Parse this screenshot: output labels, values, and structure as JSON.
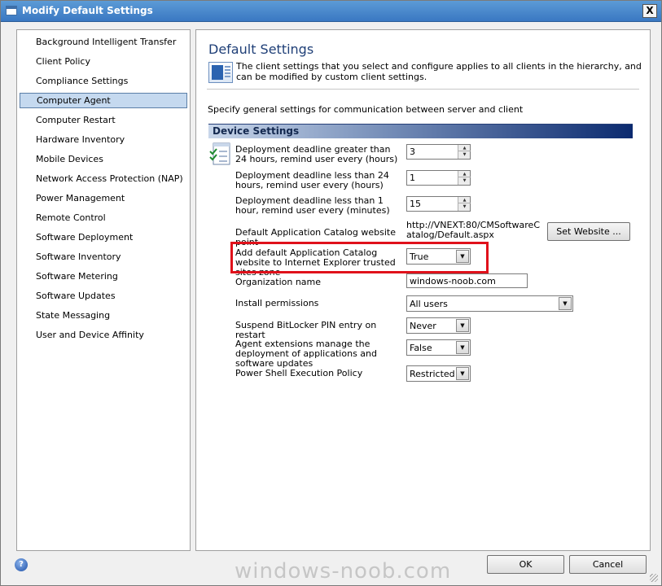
{
  "window": {
    "title": "Modify Default Settings",
    "close_label": "X"
  },
  "sidebar": {
    "items": [
      {
        "label": "Background Intelligent Transfer"
      },
      {
        "label": "Client Policy"
      },
      {
        "label": "Compliance Settings"
      },
      {
        "label": "Computer Agent",
        "selected": true
      },
      {
        "label": "Computer Restart"
      },
      {
        "label": "Hardware Inventory"
      },
      {
        "label": "Mobile Devices"
      },
      {
        "label": "Network Access Protection (NAP)"
      },
      {
        "label": "Power Management"
      },
      {
        "label": "Remote Control"
      },
      {
        "label": "Software Deployment"
      },
      {
        "label": "Software Inventory"
      },
      {
        "label": "Software Metering"
      },
      {
        "label": "Software Updates"
      },
      {
        "label": "State Messaging"
      },
      {
        "label": "User and Device Affinity"
      }
    ]
  },
  "main": {
    "title": "Default Settings",
    "description": "The client settings that you select and configure applies to all clients in the hierarchy, and can be modified by custom client settings.",
    "subtitle": "Specify general settings for communication between server and client",
    "group_title": "Device Settings",
    "fields": {
      "deadline_gt_24": {
        "label": "Deployment deadline greater than 24 hours, remind user every (hours)",
        "value": "3"
      },
      "deadline_lt_24": {
        "label": "Deployment deadline less than 24 hours, remind user every (hours)",
        "value": "1"
      },
      "deadline_lt_1": {
        "label": "Deployment deadline less than 1 hour, remind user every (minutes)",
        "value": "15"
      },
      "catalog_point": {
        "label": "Default Application Catalog website point",
        "value": "http://VNEXT:80/CMSoftwareCatalog/Default.aspx",
        "button": "Set Website ..."
      },
      "trusted_sites": {
        "label": "Add default Application Catalog website to Internet Explorer trusted sites zone",
        "value": "True"
      },
      "org_name": {
        "label": "Organization name",
        "value": "windows-noob.com"
      },
      "install_permissions": {
        "label": "Install permissions",
        "value": "All users"
      },
      "bitlocker": {
        "label": "Suspend BitLocker PIN entry on restart",
        "value": "Never"
      },
      "agent_extensions": {
        "label": "Agent extensions manage the deployment of applications and software updates",
        "value": "False"
      },
      "ps_policy": {
        "label": "Power Shell Execution Policy",
        "value": "Restricted"
      }
    }
  },
  "footer": {
    "help_label": "?",
    "ok_label": "OK",
    "cancel_label": "Cancel",
    "watermark": "windows-noob.com"
  },
  "icons": {
    "app": "window-icon",
    "help": "help-icon",
    "settings": "settings-checklist-icon",
    "header": "document-icon"
  },
  "colors": {
    "highlight": "#e0111b",
    "title_text": "#1f3f77",
    "selection": "#c5d9ef"
  }
}
